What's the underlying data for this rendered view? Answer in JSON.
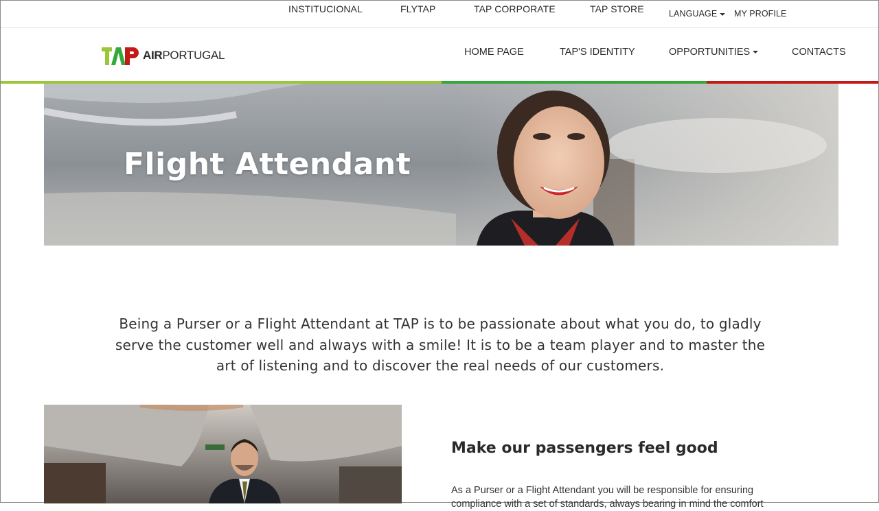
{
  "topbar": {
    "links": [
      "INSTITUCIONAL",
      "FLYTAP",
      "TAP CORPORATE",
      "TAP STORE"
    ],
    "language": "LANGUAGE",
    "profile": "MY PROFILE"
  },
  "logo": {
    "mark": "TAP",
    "word_bold": "AIR",
    "word_regular": "PORTUGAL"
  },
  "nav": {
    "home": "HOME PAGE",
    "identity": "TAP'S IDENTITY",
    "opportunities": "OPPORTUNITIES",
    "contacts": "CONTACTS"
  },
  "brand_colors": {
    "green_light": "#9bc63b",
    "green": "#36a73b",
    "red": "#c21b17"
  },
  "hero": {
    "title": "Flight Attendant"
  },
  "intro": {
    "text": "Being a Purser or a Flight Attendant at TAP is to be passionate about what you do, to gladly serve the customer well and always with a smile! It is to be a team player and to master the art of listening and to discover the real needs of our customers."
  },
  "section": {
    "title": "Make our passengers feel good",
    "body": "As a Purser or a Flight Attendant you will be responsible for ensuring compliance with a set of standards, always bearing in mind the comfort"
  }
}
